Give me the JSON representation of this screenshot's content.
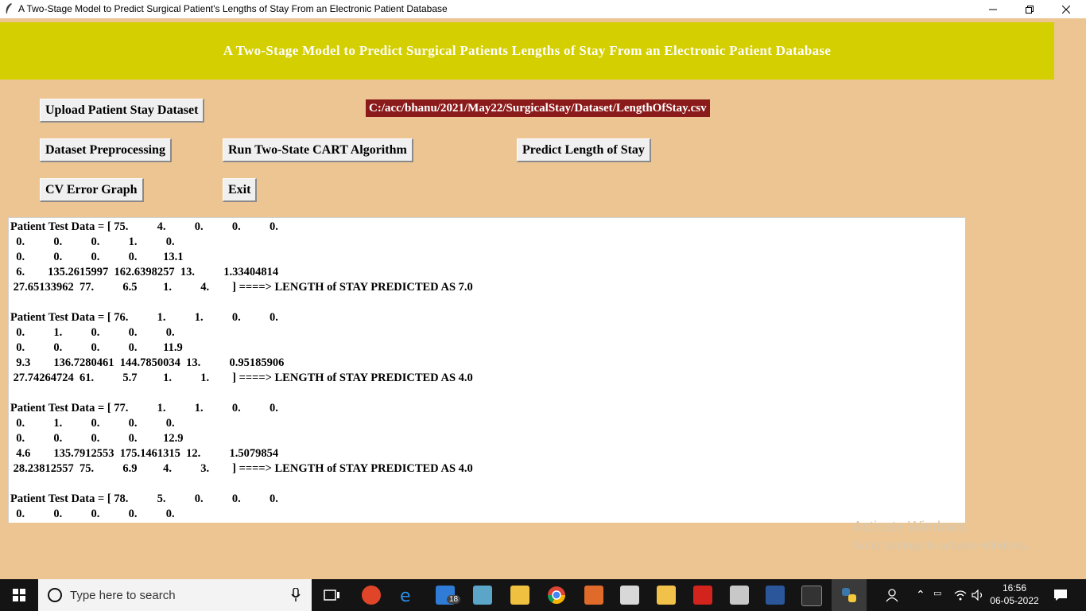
{
  "window": {
    "title": "A Two-Stage Model to Predict Surgical Patient's Lengths of Stay From an Electronic Patient Database"
  },
  "header": {
    "banner": "A Two-Stage Model to Predict Surgical Patients Lengths of Stay From an Electronic Patient Database"
  },
  "buttons": {
    "upload": "Upload Patient Stay Dataset",
    "preprocess": "Dataset Preprocessing",
    "cart": "Run Two-State CART Algorithm",
    "predict": "Predict Length of Stay",
    "cv_graph": "CV Error Graph",
    "exit": "Exit"
  },
  "dataset_path": "C:/acc/bhanu/2021/May22/SurgicalStay/Dataset/LengthOfStay.csv",
  "output_lines": [
    "Patient Test Data = [ 75.          4.          0.          0.          0.",
    "  0.          0.          0.          1.          0.",
    "  0.          0.          0.          0.         13.1",
    "  6.        135.2615997  162.6398257  13.          1.33404814",
    " 27.65133962  77.          6.5         1.          4.        ] ====> LENGTH of STAY PREDICTED AS 7.0",
    "",
    "Patient Test Data = [ 76.          1.          1.          0.          0.",
    "  0.          1.          0.          0.          0.",
    "  0.          0.          0.          0.         11.9",
    "  9.3        136.7280461  144.7850034  13.          0.95185906",
    " 27.74264724  61.          5.7         1.          1.        ] ====> LENGTH of STAY PREDICTED AS 4.0",
    "",
    "Patient Test Data = [ 77.          1.          1.          0.          0.",
    "  0.          1.          0.          0.          0.",
    "  0.          0.          0.          0.         12.9",
    "  4.6        135.7912553  175.1461315  12.          1.5079854",
    " 28.23812557  75.          6.9         4.          3.        ] ====> LENGTH of STAY PREDICTED AS 4.0",
    "",
    "Patient Test Data = [ 78.          5.          0.          0.          0.",
    "  0.          0.          0.          0.          0."
  ],
  "watermark": {
    "line1": "Activate Windows",
    "line2": "Go to Settings to activate Windows."
  },
  "taskbar": {
    "search_placeholder": "Type here to search",
    "time": "16:56",
    "date": "06-05-2022",
    "mail_badge": "18"
  }
}
